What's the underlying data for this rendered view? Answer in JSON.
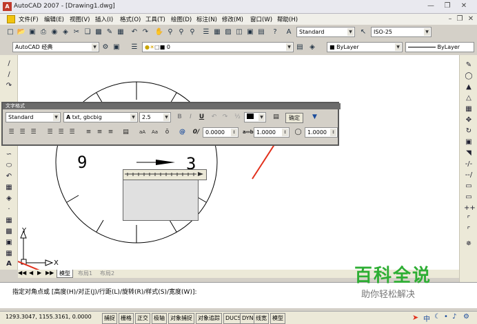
{
  "window": {
    "title": "AutoCAD 2007 - [Drawing1.dwg]"
  },
  "menu": [
    {
      "id": "file",
      "label": "文件(F)"
    },
    {
      "id": "edit",
      "label": "编辑(E)"
    },
    {
      "id": "view",
      "label": "视图(V)"
    },
    {
      "id": "insert",
      "label": "插入(I)"
    },
    {
      "id": "format",
      "label": "格式(O)"
    },
    {
      "id": "tools",
      "label": "工具(T)"
    },
    {
      "id": "draw",
      "label": "绘图(D)"
    },
    {
      "id": "dimension",
      "label": "标注(N)"
    },
    {
      "id": "modify",
      "label": "修改(M)"
    },
    {
      "id": "window",
      "label": "窗口(W)"
    },
    {
      "id": "help",
      "label": "帮助(H)"
    }
  ],
  "toolbar": {
    "text_style": "Standard",
    "dim_style": "ISO-25",
    "workspace": "AutoCAD 经典",
    "layer": "0",
    "color": "ByLayer",
    "linetype": "ByLayer"
  },
  "text_formatting": {
    "title": "文字格式",
    "style": "Standard",
    "font": "txt, gbcbig",
    "height": "2.5",
    "ok_label": "确定",
    "oblique": "0.0000",
    "tracking": "1.0000",
    "width_factor": "1.0000",
    "bold": "B",
    "italic": "I",
    "underline": "U",
    "color_swatch": "#000000"
  },
  "drawing": {
    "label_9": "9",
    "label_3": "3",
    "axis_x": "X",
    "axis_y": "Y"
  },
  "layout_tabs": [
    "模型",
    "布局1",
    "布局2"
  ],
  "command": {
    "prompt": "指定对角点或 [高度(H)/对正(J)/行距(L)/旋转(R)/样式(S)/宽度(W)]:"
  },
  "status": {
    "coords": "1293.3047, 1155.3161, 0.0000",
    "buttons": [
      "捕捉",
      "栅格",
      "正交",
      "极轴",
      "对象捕捉",
      "对象追踪",
      "DUCS",
      "DYN",
      "线宽",
      "模型"
    ]
  },
  "watermark": {
    "title": "百科全说",
    "subtitle": "助你轻松解决"
  },
  "colors": {
    "arrow": "#e2301c",
    "watermark_green": "#2eae34",
    "canvas": "#ffffff"
  }
}
